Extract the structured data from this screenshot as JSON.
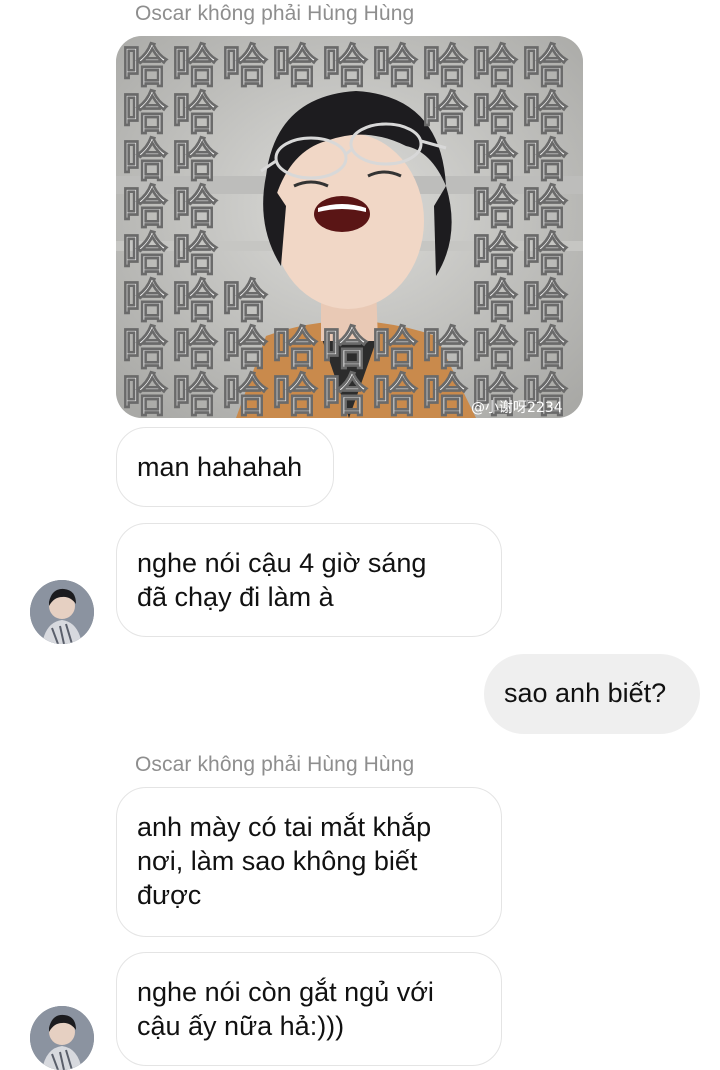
{
  "conversation": {
    "sender_name_top": "Oscar không phải Hùng Hùng",
    "image_message": {
      "glyph": "哈",
      "watermark": "@小谢呀2234"
    },
    "messages": [
      {
        "text": "man hahahah"
      },
      {
        "lines": [
          "nghe nói cậu 4 giờ sáng",
          "đã chạy đi làm à"
        ]
      },
      {
        "text": "sao anh biết?"
      },
      {
        "lines": [
          "anh mày có tai mắt khắp",
          "nơi, làm sao không biết",
          "được"
        ]
      },
      {
        "lines": [
          "nghe nói còn gắt ngủ với",
          "cậu ấy nữa hả:)))"
        ]
      }
    ],
    "sender_name_bottom": "Oscar không phải Hùng Hùng"
  },
  "colors": {
    "incoming_bubble_bg": "#ffffff",
    "incoming_bubble_border": "#e4e4e4",
    "outgoing_bubble_bg": "#efefef",
    "sender_name": "#8e8e8e"
  },
  "icons": {
    "avatar": "profile-photo",
    "meme": "laughing-meme-image"
  }
}
